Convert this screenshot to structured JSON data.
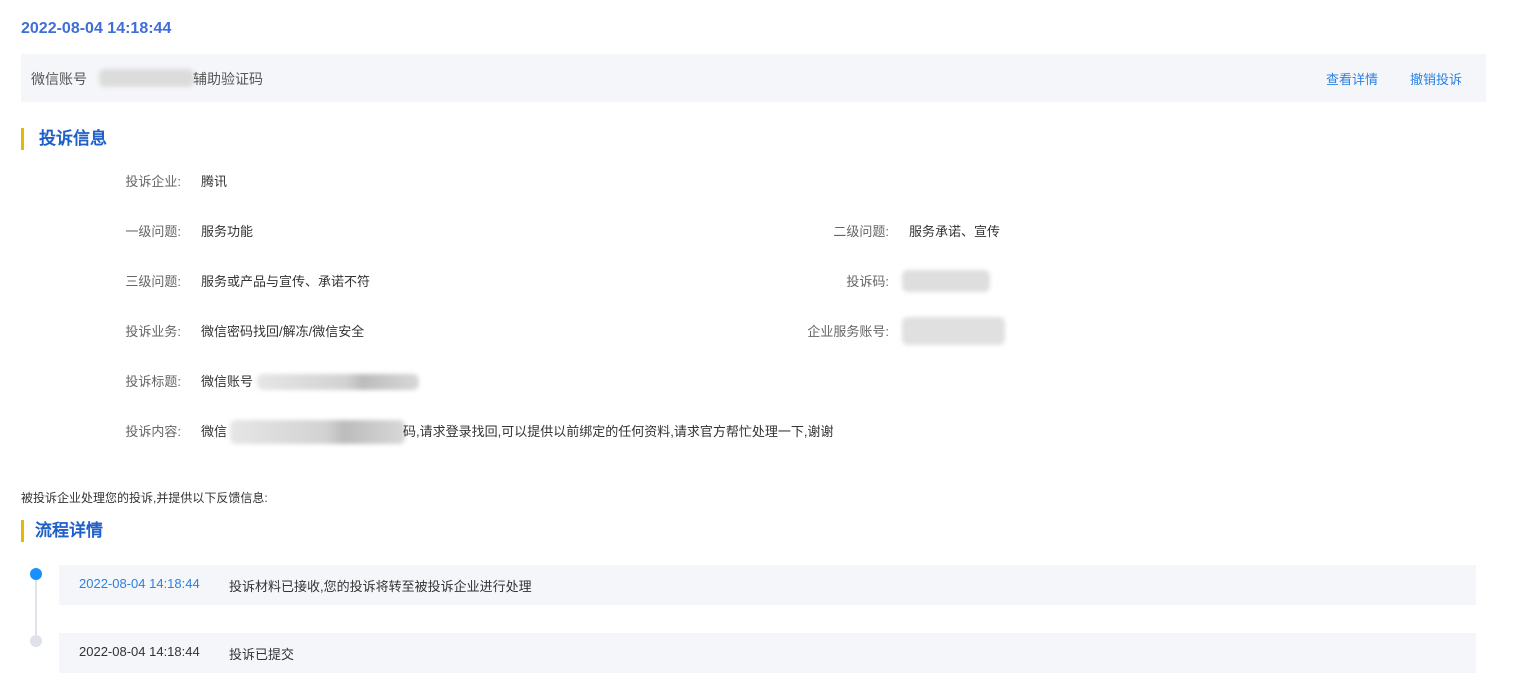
{
  "header": {
    "timestamp": "2022-08-04 14:18:44"
  },
  "summary": {
    "account_label": "微信账号",
    "account_suffix": "辅助验证码",
    "view_detail": "查看详情",
    "revoke": "撤销投诉"
  },
  "info": {
    "title": "投诉信息",
    "company_label": "投诉企业:",
    "company_value": "腾讯",
    "level1_label": "一级问题:",
    "level1_value": "服务功能",
    "level2_label": "二级问题:",
    "level2_value": "服务承诺、宣传",
    "level3_label": "三级问题:",
    "level3_value": "服务或产品与宣传、承诺不符",
    "code_label": "投诉码:",
    "business_label": "投诉业务:",
    "business_value": "微信密码找回/解冻/微信安全",
    "service_account_label": "企业服务账号:",
    "subject_label": "投诉标题:",
    "subject_prefix": "微信账号",
    "content_label": "投诉内容:",
    "content_prefix": "微信",
    "content_suffix": "码,请求登录找回,可以提供以前绑定的任何资料,请求官方帮忙处理一下,谢谢"
  },
  "note": "被投诉企业处理您的投诉,并提供以下反馈信息:",
  "flow": {
    "title": "流程详情",
    "items": [
      {
        "time": "2022-08-04 14:18:44",
        "text": "投诉材料已接收,您的投诉将转至被投诉企业进行处理"
      },
      {
        "time": "2022-08-04 14:18:44",
        "text": "投诉已提交"
      }
    ]
  }
}
